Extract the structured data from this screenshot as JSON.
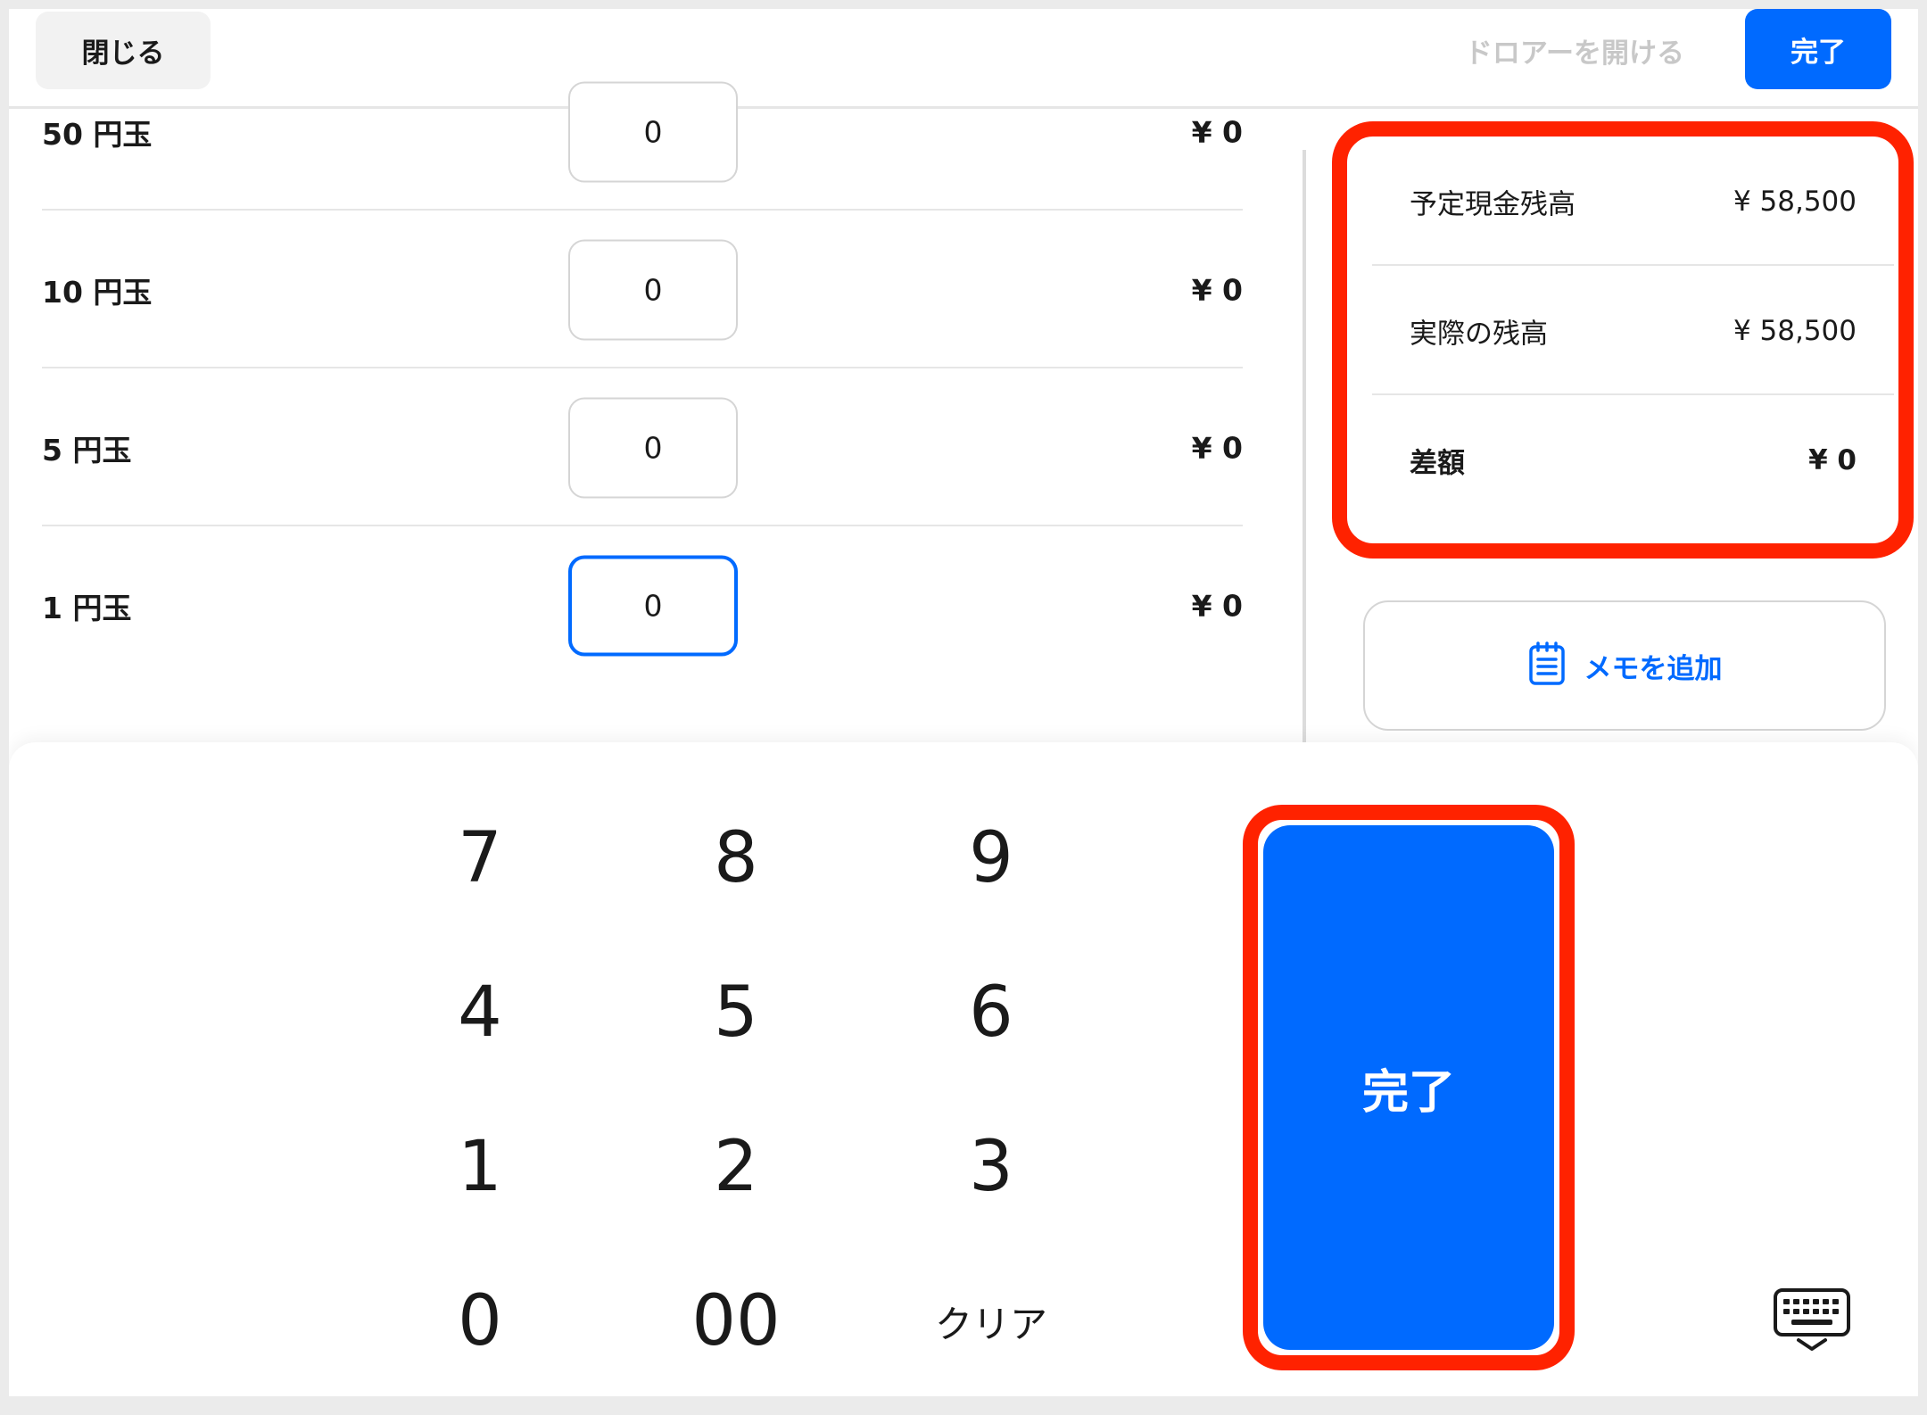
{
  "header": {
    "close_label": "閉じる",
    "open_drawer_label": "ドロアーを開ける",
    "done_label": "完了"
  },
  "denominations": [
    {
      "label": "50 円玉",
      "count": "0",
      "amount": "¥ 0"
    },
    {
      "label": "10 円玉",
      "count": "0",
      "amount": "¥ 0"
    },
    {
      "label": "5 円玉",
      "count": "0",
      "amount": "¥ 0"
    },
    {
      "label": "1 円玉",
      "count": "0",
      "amount": "¥ 0"
    }
  ],
  "summary": {
    "expected_label": "予定現金残高",
    "expected_value": "¥ 58,500",
    "actual_label": "実際の残高",
    "actual_value": "¥ 58,500",
    "diff_label": "差額",
    "diff_value": "¥ 0"
  },
  "memo": {
    "label": "メモを追加",
    "icon": "notepad-icon"
  },
  "keypad": {
    "keys": [
      "7",
      "8",
      "9",
      "4",
      "5",
      "6",
      "1",
      "2",
      "3",
      "0",
      "00",
      "クリア"
    ],
    "done_label": "完了",
    "keyboard_icon": "keyboard-icon"
  },
  "colors": {
    "accent": "#006aff",
    "highlight": "#ff2200",
    "border": "#d5d5d5"
  }
}
